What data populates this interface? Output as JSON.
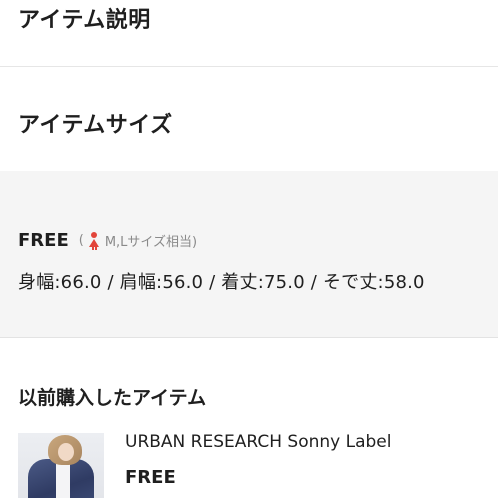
{
  "description_section": {
    "title": "アイテム説明"
  },
  "size_section": {
    "title": "アイテムサイズ",
    "size_name": "FREE",
    "note_open": "(",
    "note_icon": "female-icon",
    "note_text": "M,Lサイズ相当)",
    "note_icon_color": "#e2453a",
    "measurements": "身幅:66.0 / 肩幅:56.0 / 着丈:75.0 / そで丈:58.0"
  },
  "history_section": {
    "title": "以前購入したアイテム",
    "items": [
      {
        "brand": "URBAN RESEARCH Sonny Label",
        "size": "FREE"
      }
    ]
  },
  "colors": {
    "panel_background": "#f5f5f5",
    "divider": "#e6e6e6",
    "note_text": "#8a8a8a"
  }
}
